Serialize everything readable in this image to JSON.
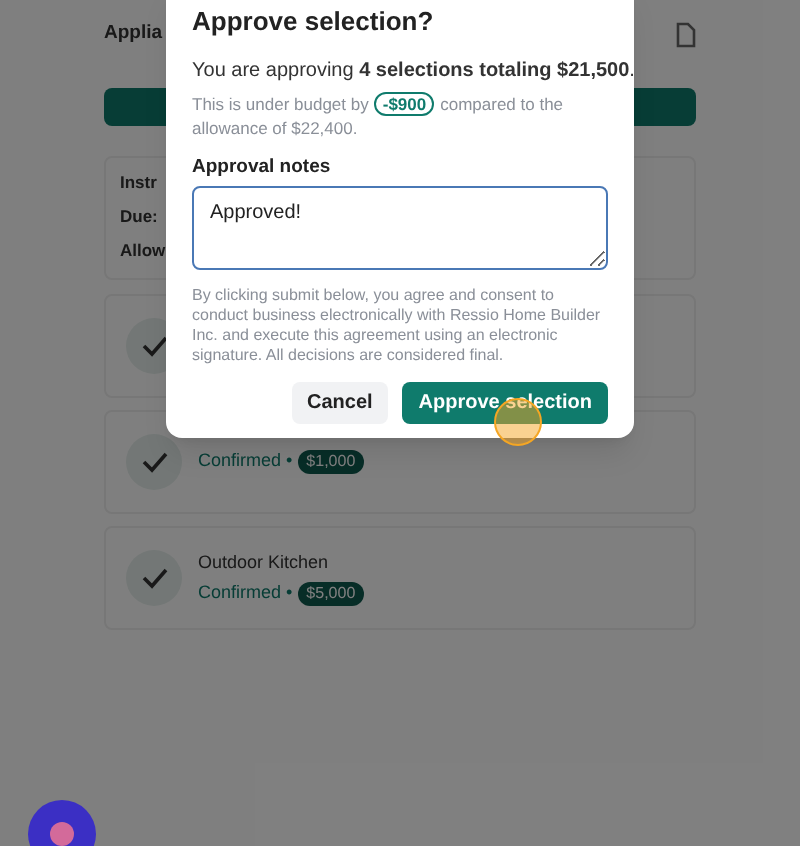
{
  "page": {
    "title": "Applia",
    "details": [
      "Instr",
      "Due:",
      "Allow"
    ],
    "items": [
      {
        "checked": true
      },
      {
        "checked": true,
        "status": "Confirmed •",
        "amount": "$1,000"
      },
      {
        "checked": true,
        "name": "Outdoor Kitchen",
        "status": "Confirmed •",
        "amount": "$5,000"
      }
    ]
  },
  "dialog": {
    "title": "Approve selection?",
    "summary": "You are approving **4 selections totaling $21,500**.",
    "budget_before": "This is under budget by",
    "budget_badge": "-$900",
    "budget_after": "compared to the",
    "budget_line2": "allowance of $22,400.",
    "notes_label": "Approval notes",
    "notes_value": "Approved!",
    "disclaimer": "By clicking submit below, you agree and consent to conduct business electronically with Ressio Home Builder Inc. and execute this agreement using an electronic signature. All decisions are considered final.",
    "buttons": [
      {
        "kind": "secondary",
        "label": "Cancel"
      },
      {
        "kind": "primary",
        "label": "Approve selection"
      }
    ]
  }
}
